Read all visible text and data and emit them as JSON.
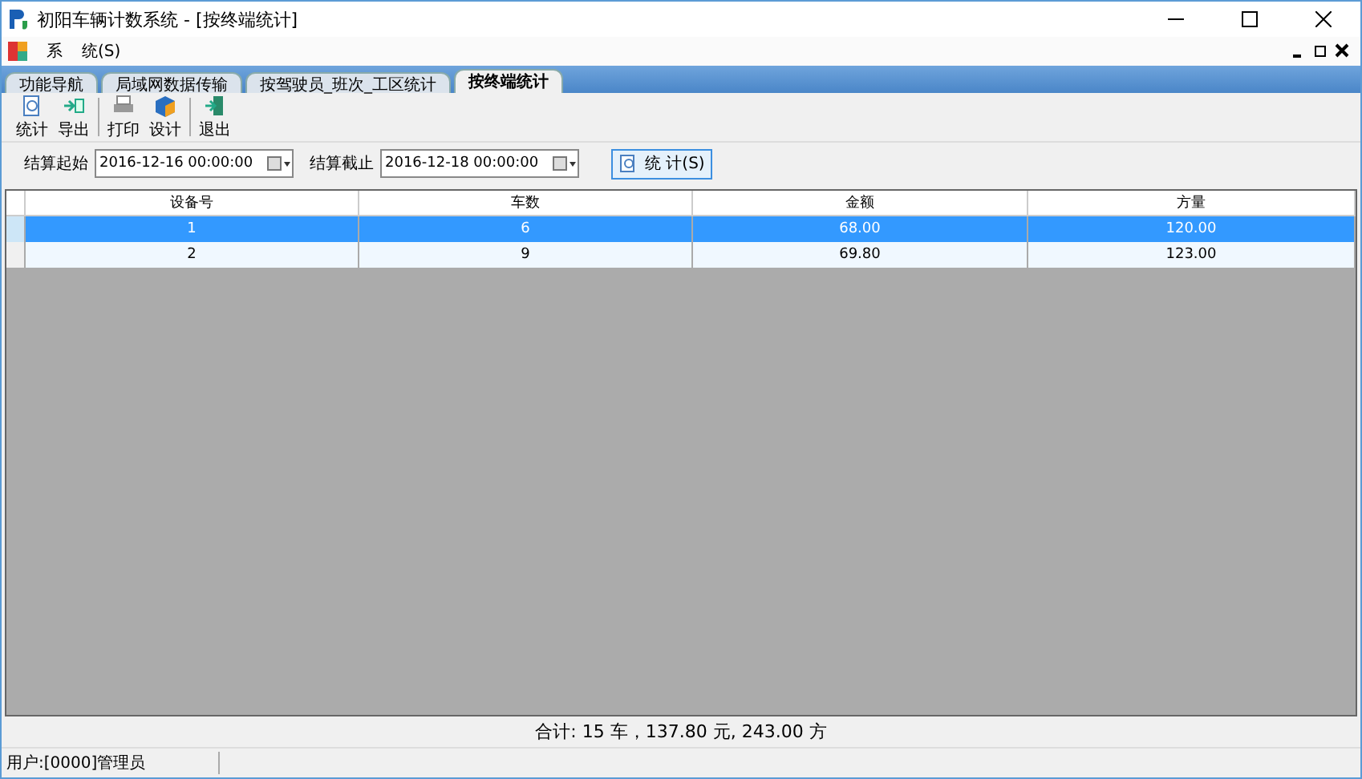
{
  "window": {
    "title": "初阳车辆计数系统 - [按终端统计]"
  },
  "menu": [
    "系",
    "统(S)"
  ],
  "tabs": [
    {
      "label": "功能导航",
      "selected": false
    },
    {
      "label": "局域网数据传输",
      "selected": false
    },
    {
      "label": "按驾驶员_班次_工区统计",
      "selected": false
    },
    {
      "label": "按终端统计",
      "selected": true
    }
  ],
  "toolbar": [
    {
      "label": "统计",
      "kind": "stat"
    },
    {
      "label": "导出",
      "kind": "export"
    },
    {
      "label": "打印",
      "kind": "print",
      "group_start": true
    },
    {
      "label": "设计",
      "kind": "design"
    },
    {
      "label": "退出",
      "kind": "exit",
      "group_start": true
    }
  ],
  "filters": [
    {
      "label": "结算起始",
      "value": "2016-12-16 00:00:00"
    },
    {
      "label": "结算截止",
      "value": "2016-12-18 00:00:00"
    }
  ],
  "stat_button": "统 计(S)",
  "table": {
    "columns": [
      "设备号",
      "车数",
      "金额",
      "方量"
    ],
    "rows": [
      {
        "cells": [
          "1",
          "6",
          "68.00",
          "120.00"
        ],
        "selected": true
      },
      {
        "cells": [
          "2",
          "9",
          "69.80",
          "123.00"
        ],
        "selected": false
      }
    ]
  },
  "total": "合计: 15 车，137.80 元, 243.00 方",
  "status_bar": "用户:[0000]管理员"
}
